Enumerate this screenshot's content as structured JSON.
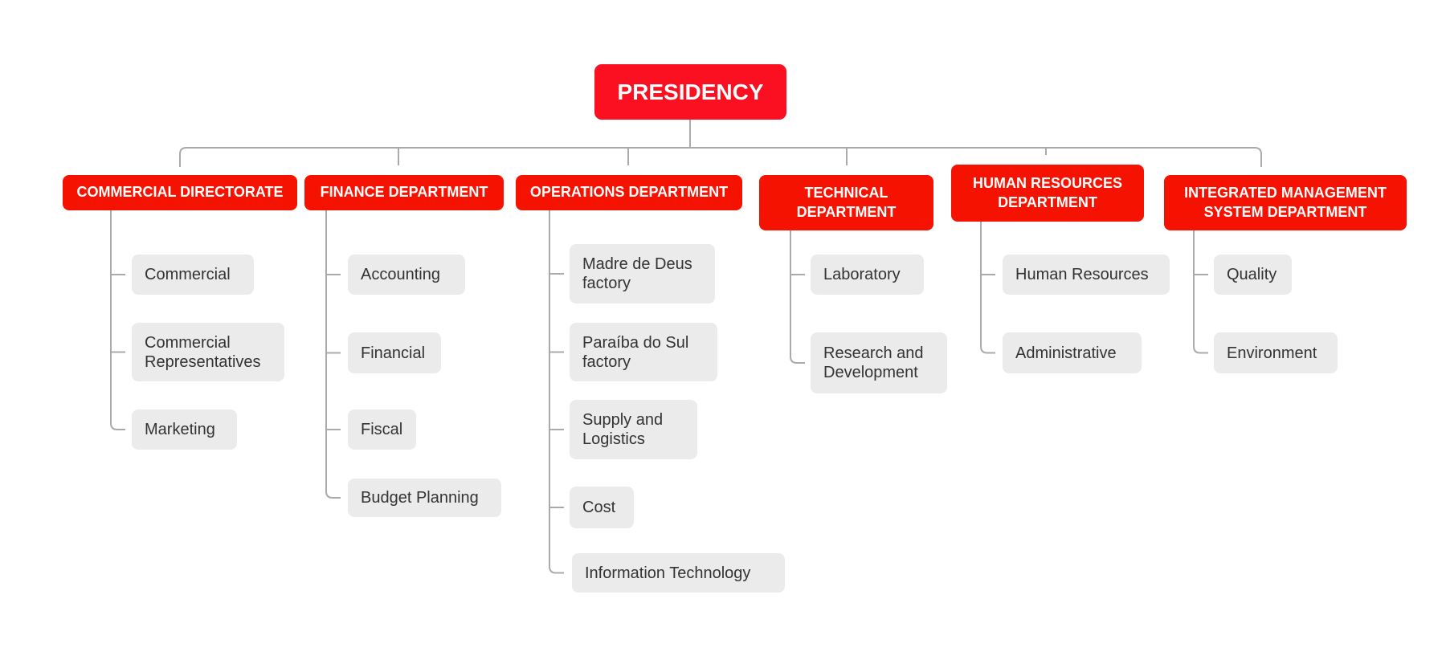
{
  "root": {
    "label": "PRESIDENCY"
  },
  "colors": {
    "root": "#fa1020",
    "department": "#f51200",
    "child": "#ebebeb",
    "line": "#aaaaaa"
  },
  "departments": [
    {
      "label": "COMMERCIAL DIRECTORATE",
      "children": [
        "Commercial",
        "Commercial Representatives",
        "Marketing"
      ]
    },
    {
      "label": "FINANCE DEPARTMENT",
      "children": [
        "Accounting",
        "Financial",
        "Fiscal",
        "Budget Planning"
      ]
    },
    {
      "label": "OPERATIONS DEPARTMENT",
      "children": [
        "Madre de Deus factory",
        "Paraíba do Sul factory",
        "Supply and Logistics",
        "Cost",
        "Information Technology"
      ]
    },
    {
      "label": "TECHNICAL DEPARTMENT",
      "children": [
        "Laboratory",
        "Research and Development"
      ]
    },
    {
      "label": "HUMAN RESOURCES DEPARTMENT",
      "children": [
        "Human Resources",
        "Administrative"
      ]
    },
    {
      "label": "INTEGRATED MANAGEMENT SYSTEM DEPARTMENT",
      "children": [
        "Quality",
        "Environment"
      ]
    }
  ]
}
